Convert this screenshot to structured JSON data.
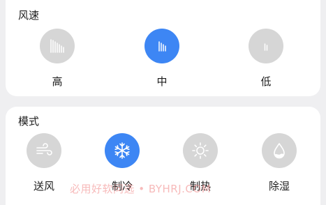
{
  "fan_speed": {
    "title": "风速",
    "options": [
      {
        "label": "高",
        "icon": "fan-speed-high-icon",
        "selected": false
      },
      {
        "label": "中",
        "icon": "fan-speed-medium-icon",
        "selected": true
      },
      {
        "label": "低",
        "icon": "fan-speed-low-icon",
        "selected": false
      }
    ]
  },
  "mode": {
    "title": "模式",
    "options": [
      {
        "label": "送风",
        "icon": "wind-icon",
        "selected": false
      },
      {
        "label": "制冷",
        "icon": "snowflake-icon",
        "selected": true
      },
      {
        "label": "制热",
        "icon": "sun-icon",
        "selected": false
      },
      {
        "label": "除湿",
        "icon": "droplet-icon",
        "selected": false
      }
    ]
  },
  "watermark": "必用好软问选 • BYHRJ.COM",
  "colors": {
    "active": "#3d86f4",
    "inactive": "#d6d6d6",
    "card": "#ffffff",
    "background": "#efeff1"
  }
}
